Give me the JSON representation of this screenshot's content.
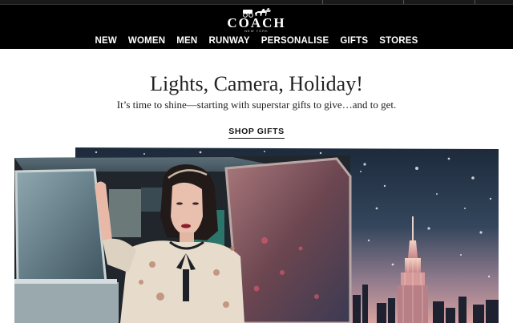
{
  "brand": {
    "name": "COACH",
    "location": "NEW YORK"
  },
  "nav": {
    "items": [
      "NEW",
      "WOMEN",
      "MEN",
      "RUNWAY",
      "PERSONALISE",
      "GIFTS",
      "STORES"
    ]
  },
  "hero": {
    "headline": "Lights, Camera, Holiday!",
    "subline": "It’s time to shine—starting with superstar gifts to give…and to get.",
    "cta_label": "SHOP GIFTS"
  },
  "colors": {
    "header_bg": "#000000",
    "text": "#222222",
    "night_sky": "#1f2e40",
    "dusk_pink": "#c98a8f"
  }
}
